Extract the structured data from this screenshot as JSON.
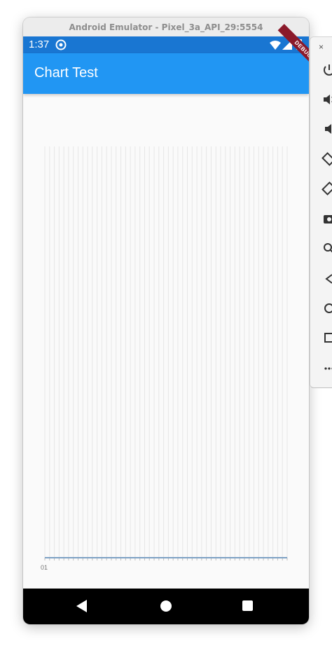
{
  "window": {
    "title": "Android Emulator - Pixel_3a_API_29:5554"
  },
  "status_bar": {
    "time": "1:37",
    "debug_banner": "DEBUG"
  },
  "app_bar": {
    "title": "Chart Test"
  },
  "chart_data": {
    "type": "bar",
    "x_tick_labels": [
      "01"
    ],
    "gridlines_vertical": 52,
    "grid": true
  },
  "side_panel": {
    "close_label": "×",
    "controls": [
      "power-icon",
      "volume-up-icon",
      "volume-down-icon",
      "rotate-left-icon",
      "rotate-right-icon",
      "camera-icon",
      "zoom-icon",
      "back-icon",
      "home-icon",
      "overview-icon",
      "more-icon"
    ]
  }
}
